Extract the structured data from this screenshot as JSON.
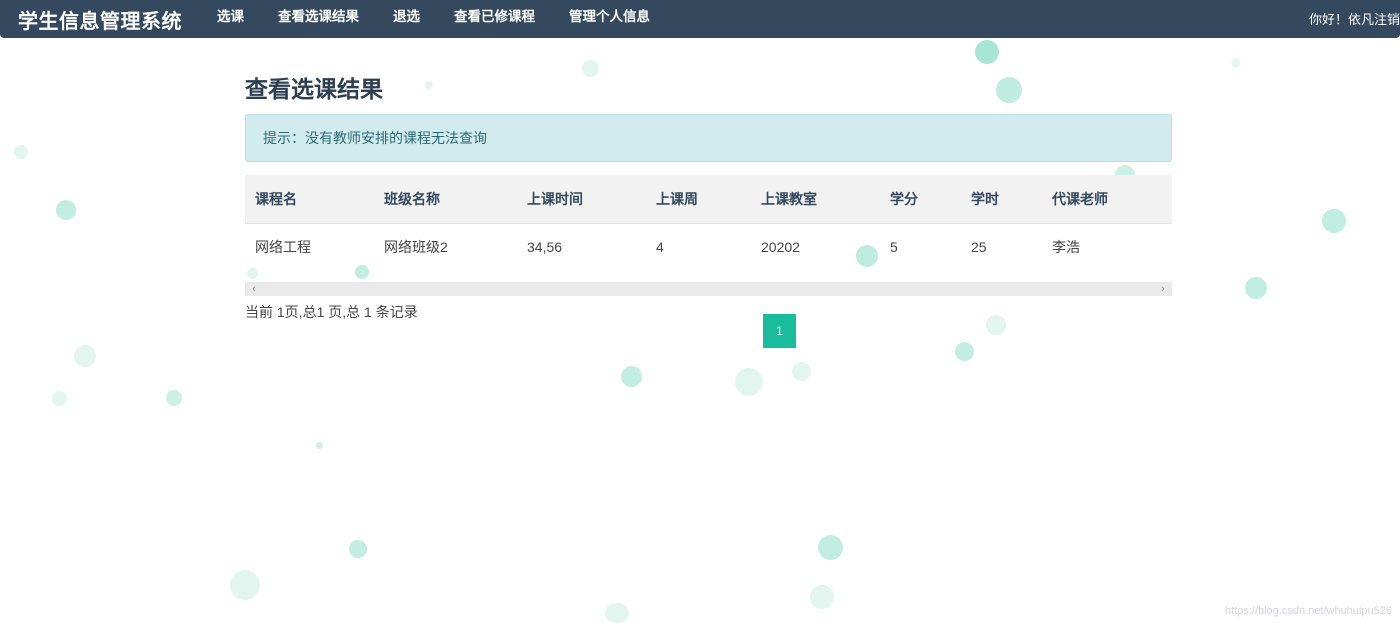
{
  "navbar": {
    "brand": "学生信息管理系统",
    "items": [
      {
        "label": "选课"
      },
      {
        "label": "查看选课结果"
      },
      {
        "label": "退选"
      },
      {
        "label": "查看已修课程"
      },
      {
        "label": "管理个人信息"
      }
    ],
    "greeting": "你好！依凡",
    "logout": "注销"
  },
  "page": {
    "title": "查看选课结果",
    "alert": "提示：没有教师安排的课程无法查询"
  },
  "table": {
    "headers": [
      "课程名",
      "班级名称",
      "上课时间",
      "上课周",
      "上课教室",
      "学分",
      "学时",
      "代课老师"
    ],
    "rows": [
      [
        "网络工程",
        "网络班级2",
        "34,56",
        "4",
        "20202",
        "5",
        "25",
        "李浩"
      ]
    ]
  },
  "pagination": {
    "info": "当前 1页,总1 页,总 1 条记录",
    "pages": [
      "1"
    ],
    "current": "1"
  },
  "watermark": "https://blog.csdn.net/whuhuipu526",
  "colors": {
    "navbar": "#34495e",
    "accent": "#1abc9c",
    "alert_bg": "#d1ebef"
  }
}
